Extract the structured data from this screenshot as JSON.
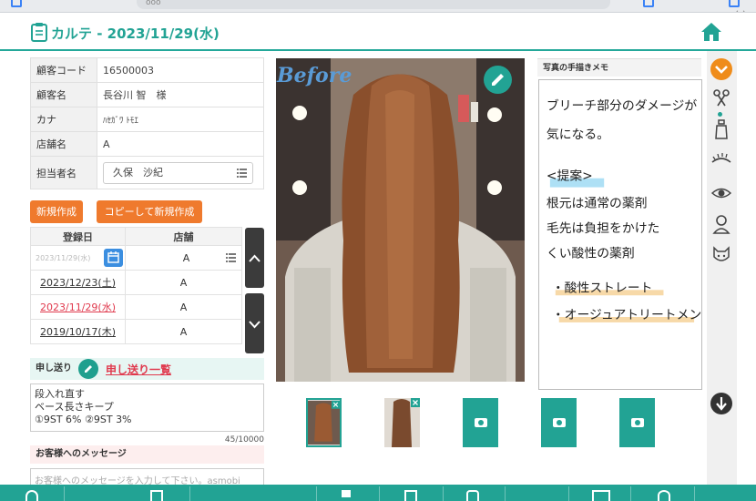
{
  "browser": {
    "url_text": "ooo"
  },
  "header": {
    "title": "カルテ - 2023/11/29(水)",
    "accent": "#22a394"
  },
  "customer": {
    "rows": [
      {
        "label": "顧客コード",
        "value": "16500003"
      },
      {
        "label": "顧客名",
        "value": "長谷川 智　様"
      },
      {
        "label": "カナ",
        "value": "ﾊｾｶﾞﾜ ﾄﾓｴ"
      },
      {
        "label": "店舗名",
        "value": "A"
      }
    ],
    "staff_label": "担当者名",
    "staff_value": "久保　沙紀"
  },
  "actions": {
    "new_label": "新規作成",
    "copy_label": "コピーして新規作成"
  },
  "history": {
    "headers": [
      "登録日",
      "店舗"
    ],
    "date_placeholder": "2023/11/29(水)",
    "store_value": "A",
    "rows": [
      {
        "date": "2023/12/23(土)",
        "store": "A",
        "highlight": false
      },
      {
        "date": "2023/11/29(水)",
        "store": "A",
        "highlight": true
      },
      {
        "date": "2019/10/17(木)",
        "store": "A",
        "highlight": false
      }
    ]
  },
  "handover": {
    "title": "申し送り",
    "link_label": "申し送り一覧",
    "lines": [
      "段入れ直す",
      "ベース長さキープ",
      "①9ST 6% ②9ST 3%"
    ],
    "counter": "45/10000"
  },
  "customer_message": {
    "title": "お客様へのメッセージ",
    "placeholder": "お客様へのメッセージを入力して下さい。asmobi"
  },
  "photo": {
    "label": "Before"
  },
  "memo": {
    "title": "写真の手描きメモ",
    "lines": [
      "ブリーチ部分のダメージが",
      "気になる。",
      "<提案>",
      "根元は通常の薬剤",
      "毛先は負担をかけた",
      "くい酸性の薬剤",
      "・酸性ストレート",
      "・オージュアトリートメント"
    ]
  },
  "toolbar": {
    "icons": [
      "chevron-down-icon",
      "scissors-icon",
      "bottle-icon",
      "eyelash-icon",
      "eye-icon",
      "person-icon",
      "pet-icon",
      "arrow-down-icon"
    ]
  }
}
